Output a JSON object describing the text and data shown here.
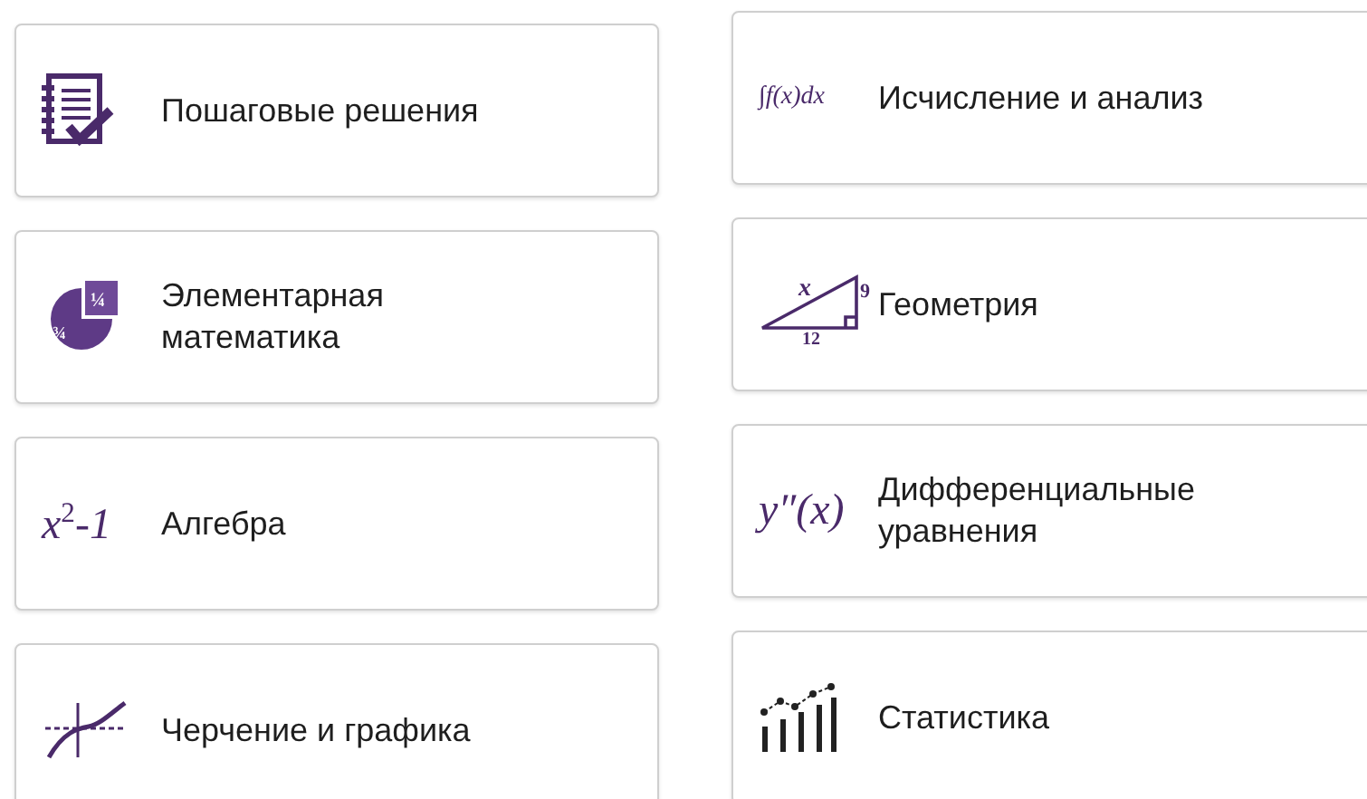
{
  "columns": [
    {
      "cards": [
        {
          "label": "Пошаговые решения",
          "icon": {
            "kind": "notebook"
          }
        },
        {
          "label": "Элементарная математика",
          "icon": {
            "kind": "pie",
            "texts": [
              "¼",
              "¾"
            ]
          }
        },
        {
          "label": "Алгебра",
          "icon": {
            "kind": "formula",
            "texts": [
              "x$^{2}$-1"
            ]
          }
        },
        {
          "label": "Черчение и графика",
          "icon": {
            "kind": "graph"
          }
        }
      ]
    },
    {
      "cards": [
        {
          "label": "Исчисление и анализ",
          "icon": {
            "kind": "formula-small",
            "texts": [
              "∫f(x)dx"
            ]
          }
        },
        {
          "label": "Геометрия",
          "icon": {
            "kind": "triangle",
            "texts": [
              "x",
              "9",
              "12"
            ]
          }
        },
        {
          "label": "Дифференциальные уравнения",
          "icon": {
            "kind": "formula",
            "texts": [
              "y″(x)"
            ]
          }
        },
        {
          "label": "Статистика",
          "icon": {
            "kind": "stats"
          }
        }
      ]
    }
  ]
}
